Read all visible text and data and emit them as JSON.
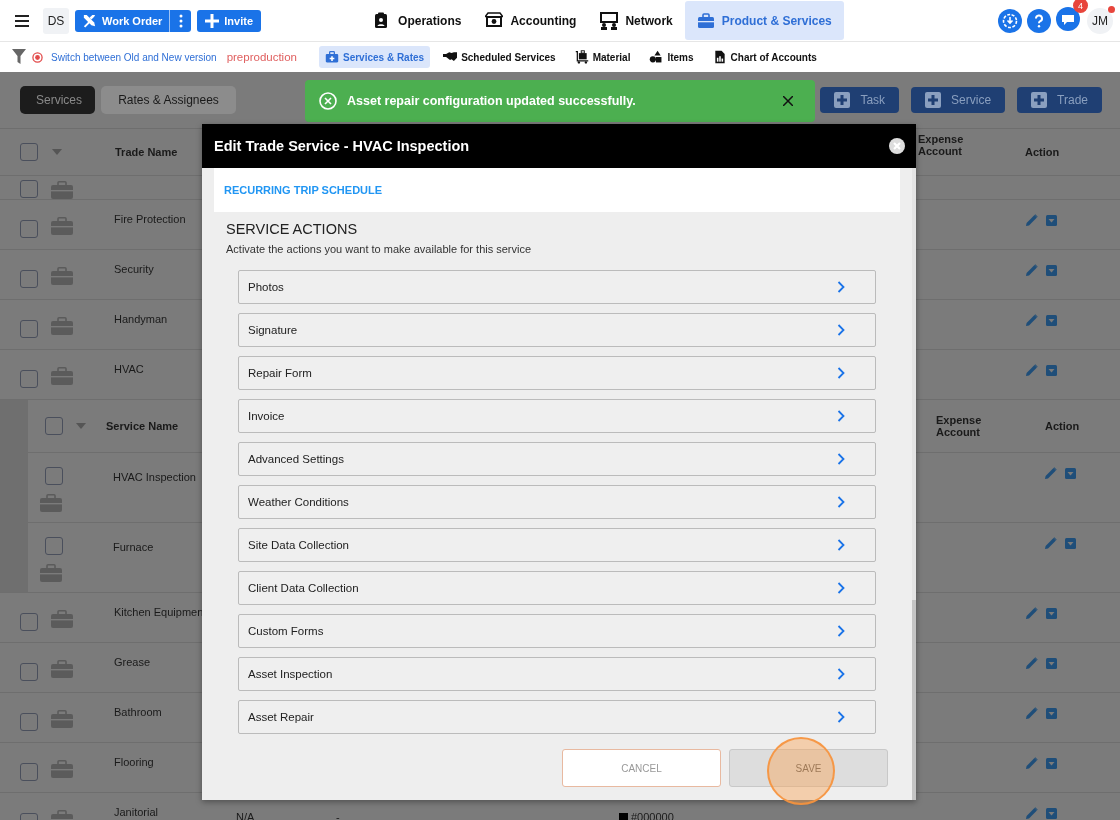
{
  "top_nav": {
    "workspace": "DS",
    "work_order_button": "Work Order",
    "invite_button": "Invite",
    "nav_items": [
      {
        "label": "Operations",
        "selected": false
      },
      {
        "label": "Accounting",
        "selected": false
      },
      {
        "label": "Network",
        "selected": false
      },
      {
        "label": "Product & Services",
        "selected": true
      }
    ],
    "notification_count": "4",
    "user_initials": "JM"
  },
  "sub_nav": {
    "version_link": "Switch between Old and New version",
    "environment": "preproduction",
    "items": [
      {
        "label": "Services & Rates",
        "selected": true
      },
      {
        "label": "Scheduled Services",
        "selected": false
      },
      {
        "label": "Material",
        "selected": false
      },
      {
        "label": "Items",
        "selected": false
      },
      {
        "label": "Chart of Accounts",
        "selected": false
      }
    ]
  },
  "view_tabs": [
    {
      "label": "Services",
      "selected": true
    },
    {
      "label": "Rates & Assignees",
      "selected": false
    }
  ],
  "add_buttons": [
    "Task",
    "Service",
    "Trade"
  ],
  "trade_table": {
    "columns": [
      "Trade Name",
      "Expense Account",
      "Action"
    ],
    "select_all_checked": false,
    "rows": [
      {
        "kind": "clipped",
        "checked": false
      },
      {
        "kind": "trade",
        "name": "Fire Protection",
        "checked": false
      },
      {
        "kind": "trade",
        "name": "Security",
        "checked": false
      },
      {
        "kind": "trade",
        "name": "Handyman",
        "checked": false
      },
      {
        "kind": "trade",
        "name": "HVAC",
        "checked": false,
        "services": {
          "columns": [
            "Service Name",
            "Expense Account",
            "Action"
          ],
          "select_all_checked": false,
          "rows": [
            {
              "name": "HVAC Inspection",
              "checked": false
            },
            {
              "name": "Furnace",
              "checked": false
            }
          ]
        }
      },
      {
        "kind": "trade",
        "name": "Kitchen Equipmen",
        "checked": false
      },
      {
        "kind": "trade",
        "name": "Grease",
        "checked": false
      },
      {
        "kind": "trade",
        "name": "Bathroom",
        "checked": false
      },
      {
        "kind": "trade",
        "name": "Flooring",
        "checked": false
      },
      {
        "kind": "trade",
        "name": "Janitorial",
        "checked": false,
        "column_2": "N/A",
        "column_3": "-",
        "color_code": "#000000",
        "color": "#000000"
      }
    ]
  },
  "toast": {
    "message": "Asset repair configuration updated successfully."
  },
  "modal": {
    "title": "Edit Trade Service - HVAC Inspection",
    "section_link": "RECURRING TRIP SCHEDULE",
    "heading": "SERVICE ACTIONS",
    "description": "Activate the actions you want to make available for this service",
    "actions": [
      "Photos",
      "Signature",
      "Repair Form",
      "Invoice",
      "Advanced Settings",
      "Weather Conditions",
      "Site Data Collection",
      "Client Data Collection",
      "Custom Forms",
      "Asset Inspection",
      "Asset Repair"
    ],
    "cancel_button": "CANCEL",
    "save_button": "SAVE"
  }
}
